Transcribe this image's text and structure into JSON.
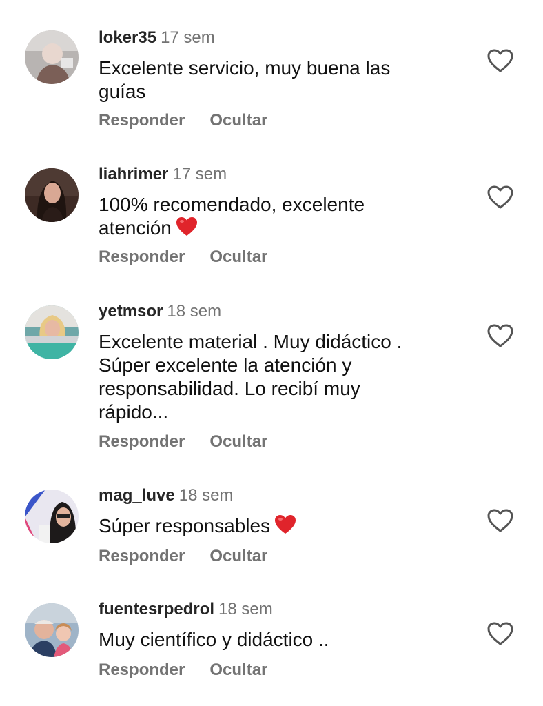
{
  "comments": [
    {
      "username": "loker35",
      "time": "17 sem",
      "lines": [
        "Excelente servicio, muy buena las",
        "guías"
      ],
      "reply_label": "Responder",
      "hide_label": "Ocultar"
    },
    {
      "username": "liahrimer",
      "time": "17 sem",
      "lines": [
        "100% recomendado, excelente",
        "atención"
      ],
      "reply_label": "Responder",
      "hide_label": "Ocultar"
    },
    {
      "username": "yetmsor",
      "time": "18 sem",
      "lines": [
        "Excelente material . Muy didáctico .",
        "Súper excelente la atención y",
        "responsabilidad. Lo recibí muy",
        "rápido..."
      ],
      "reply_label": "Responder",
      "hide_label": "Ocultar"
    },
    {
      "username": "mag_luve",
      "time": "18 sem",
      "lines": [
        "Súper responsables"
      ],
      "reply_label": "Responder",
      "hide_label": "Ocultar"
    },
    {
      "username": "fuentesrpedrol",
      "time": "18 sem",
      "lines": [
        "Muy científico y didáctico .."
      ],
      "reply_label": "Responder",
      "hide_label": "Ocultar"
    }
  ],
  "icons": {
    "like": "heart-outline-icon",
    "emoji": "red-heart-emoji"
  },
  "colors": {
    "username": "#262626",
    "secondary": "#737373",
    "heart_emoji": "#e0242b"
  }
}
